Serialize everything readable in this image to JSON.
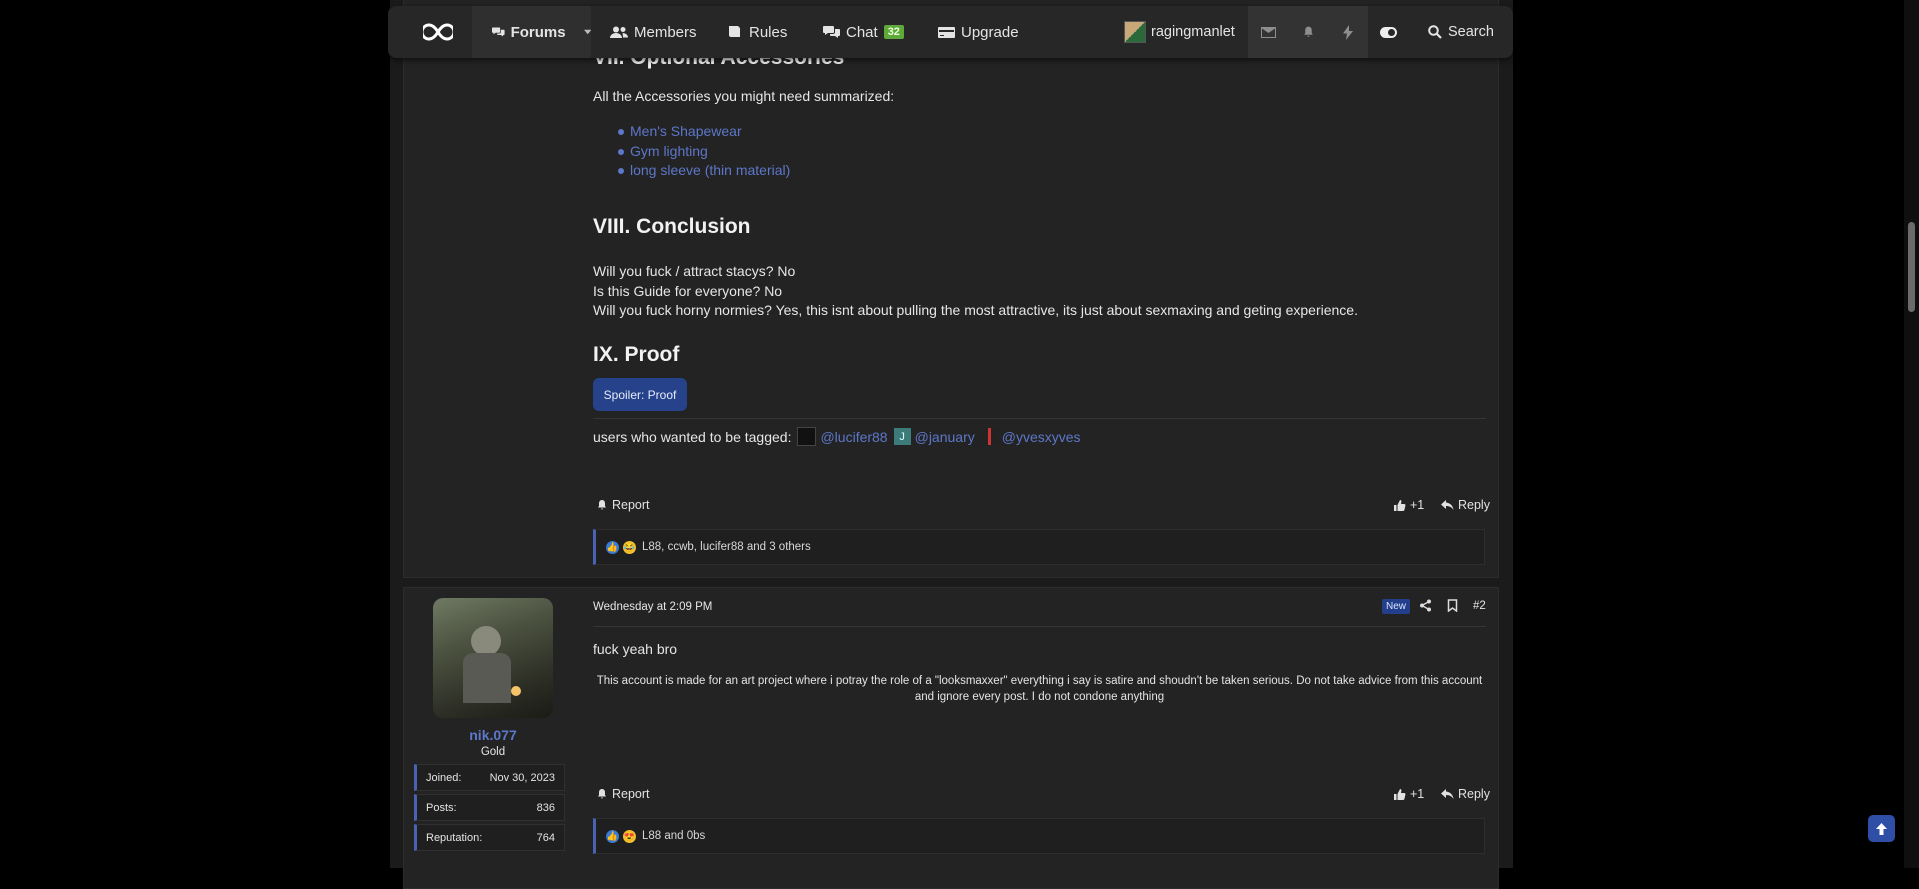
{
  "nav": {
    "forums": "Forums",
    "members": "Members",
    "rules": "Rules",
    "chat": "Chat",
    "chat_count": "32",
    "upgrade": "Upgrade",
    "username": "ragingmanlet",
    "search": "Search"
  },
  "post1": {
    "partial_heading": "VII. Optional Accessories",
    "accessories_intro": "All the Accessories you might need summarized:",
    "accessories": [
      "Men's Shapewear",
      "Gym lighting",
      "long sleeve (thin material)"
    ],
    "conclusion_heading": "VIII. Conclusion",
    "conclusion_lines": [
      "Will you fuck / attract stacys? No",
      "Is this Guide for everyone? No",
      "Will you fuck horny normies? Yes, this isnt about pulling the most attractive, its just about sexmaxing and geting experience."
    ],
    "proof_heading": "IX. Proof",
    "spoiler_label": "Spoiler: Proof",
    "tagged_intro": "users who wanted to be tagged:",
    "tagged_users": [
      "@lucifer88",
      "@january",
      "@yvesxyves"
    ],
    "tagged_avatar_letter": "J",
    "report": "Report",
    "like_count": "+1",
    "reply": "Reply",
    "reactions_text": "L88, ccwb, lucifer88 and 3 others"
  },
  "post2": {
    "username": "nik.077",
    "rank": "Gold",
    "stats": [
      {
        "label": "Joined:",
        "value": "Nov 30, 2023"
      },
      {
        "label": "Posts:",
        "value": "836"
      },
      {
        "label": "Reputation:",
        "value": "764"
      }
    ],
    "timestamp": "Wednesday at 2:09 PM",
    "new_badge": "New",
    "post_number": "#2",
    "message": "fuck yeah bro",
    "signature": "This account is made for an art project where i potray the role of a \"looksmaxxer\" everything i say is satire and shoudn't be taken serious. Do not take advice from this account and ignore every post. I do not condone anything",
    "report": "Report",
    "like_count": "+1",
    "reply": "Reply",
    "reactions_text": "L88 and 0bs"
  },
  "colors": {
    "accent": "#4a62b3",
    "link": "#5d77c9",
    "chat_badge": "#5fa83a",
    "spoiler": "#25428a"
  }
}
